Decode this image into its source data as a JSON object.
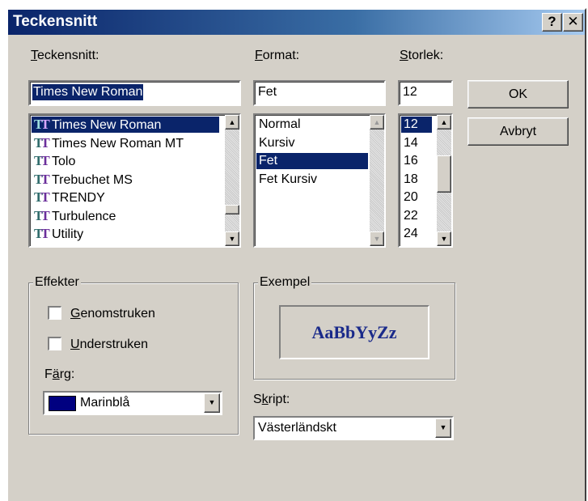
{
  "title": "Teckensnitt",
  "title_buttons": {
    "help": "?",
    "close": "✕"
  },
  "font": {
    "label_underline": "T",
    "label_rest": "eckensnitt:",
    "value": "Times New Roman",
    "items": [
      {
        "name": "Times New Roman",
        "selected": true
      },
      {
        "name": "Times New Roman MT",
        "selected": false
      },
      {
        "name": "Tolo",
        "selected": false
      },
      {
        "name": "Trebuchet MS",
        "selected": false
      },
      {
        "name": "TRENDY",
        "selected": false
      },
      {
        "name": "Turbulence",
        "selected": false
      },
      {
        "name": "Utility",
        "selected": false
      }
    ]
  },
  "style": {
    "label_underline": "F",
    "label_rest": "ormat:",
    "value": "Fet",
    "items": [
      {
        "name": "Normal",
        "selected": false
      },
      {
        "name": "Kursiv",
        "selected": false
      },
      {
        "name": "Fet",
        "selected": true
      },
      {
        "name": "Fet Kursiv",
        "selected": false
      }
    ]
  },
  "size": {
    "label_underline": "S",
    "label_rest": "torlek:",
    "value": "12",
    "items": [
      {
        "name": "12",
        "selected": true
      },
      {
        "name": "14",
        "selected": false
      },
      {
        "name": "16",
        "selected": false
      },
      {
        "name": "18",
        "selected": false
      },
      {
        "name": "20",
        "selected": false
      },
      {
        "name": "22",
        "selected": false
      },
      {
        "name": "24",
        "selected": false
      }
    ]
  },
  "buttons": {
    "ok": "OK",
    "cancel": "Avbryt"
  },
  "effects": {
    "group_label": "Effekter",
    "strikeout_u": "G",
    "strikeout_rest": "enomstruken",
    "strikeout_checked": false,
    "underline_u": "U",
    "underline_rest": "nderstruken",
    "underline_checked": false,
    "color_label_pre": "F",
    "color_label_u": "ä",
    "color_label_rest": "rg:",
    "color_value": "Marinblå",
    "color_swatch": "#000080"
  },
  "sample": {
    "group_label": "Exempel",
    "text": "AaBbYyZz"
  },
  "script": {
    "label_pre": "S",
    "label_u": "k",
    "label_rest": "ript:",
    "value": "Västerländskt"
  },
  "colors": {
    "title_start": "#0a246a",
    "title_end": "#a6caf0",
    "dialog_bg": "#d4d0c8",
    "selection": "#0a246a"
  }
}
